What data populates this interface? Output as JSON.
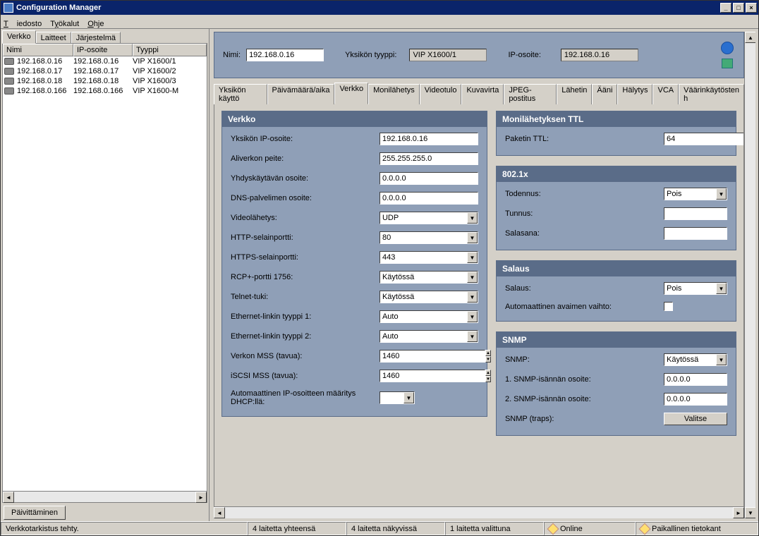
{
  "window": {
    "title": "Configuration Manager"
  },
  "menu": {
    "file": "Tiedosto",
    "tools": "Työkalut",
    "help": "Ohje"
  },
  "left_tabs": {
    "network": "Verkko",
    "devices": "Laitteet",
    "system": "Järjestelmä"
  },
  "list_headers": {
    "name": "Nimi",
    "ip": "IP-osoite",
    "type": "Tyyppi"
  },
  "devices": [
    {
      "name": "192.168.0.16",
      "ip": "192.168.0.16",
      "type": "VIP X1600/1"
    },
    {
      "name": "192.168.0.17",
      "ip": "192.168.0.17",
      "type": "VIP X1600/2"
    },
    {
      "name": "192.168.0.18",
      "ip": "192.168.0.18",
      "type": "VIP X1600/3"
    },
    {
      "name": "192.168.0.166",
      "ip": "192.168.0.166",
      "type": "VIP X1600-M"
    }
  ],
  "refresh_btn": "Päivittäminen",
  "header": {
    "name_lbl": "Nimi:",
    "name_val": "192.168.0.16",
    "type_lbl": "Yksikön tyyppi:",
    "type_val": "VIP X1600/1",
    "ip_lbl": "IP-osoite:",
    "ip_val": "192.168.0.16"
  },
  "tabs": {
    "usage": "Yksikön käyttö",
    "datetime": "Päivämäärä/aika",
    "network": "Verkko",
    "multicast": "Monilähetys",
    "videoin": "Videotulo",
    "stream": "Kuvavirta",
    "jpeg": "JPEG-postitus",
    "tx": "Lähetin",
    "audio": "Ääni",
    "alarm": "Hälytys",
    "vca": "VCA",
    "misuse": "Väärinkäytösten h"
  },
  "panels": {
    "network": {
      "title": "Verkko",
      "unit_ip_lbl": "Yksikön IP-osoite:",
      "unit_ip_val": "192.168.0.16",
      "subnet_lbl": "Aliverkon peite:",
      "subnet_val": "255.255.255.0",
      "gateway_lbl": "Yhdyskäytävän osoite:",
      "gateway_val": "0.0.0.0",
      "dns_lbl": "DNS-palvelimen osoite:",
      "dns_val": "0.0.0.0",
      "videotx_lbl": "Videolähetys:",
      "videotx_val": "UDP",
      "http_lbl": "HTTP-selainportti:",
      "http_val": "80",
      "https_lbl": "HTTPS-selainportti:",
      "https_val": "443",
      "rcp_lbl": "RCP+-portti 1756:",
      "rcp_val": "Käytössä",
      "telnet_lbl": "Telnet-tuki:",
      "telnet_val": "Käytössä",
      "eth1_lbl": "Ethernet-linkin tyyppi 1:",
      "eth1_val": "Auto",
      "eth2_lbl": "Ethernet-linkin tyyppi 2:",
      "eth2_val": "Auto",
      "mss_lbl": "Verkon MSS (tavua):",
      "mss_val": "1460",
      "iscsi_lbl": "iSCSI MSS (tavua):",
      "iscsi_val": "1460",
      "dhcp_lbl": "Automaattinen IP-osoitteen määritys DHCP:llä:"
    },
    "ttl": {
      "title": "Monilähetyksen TTL",
      "packet_lbl": "Paketin TTL:",
      "packet_val": "64"
    },
    "dot1x": {
      "title": "802.1x",
      "auth_lbl": "Todennus:",
      "auth_val": "Pois",
      "id_lbl": "Tunnus:",
      "id_val": "",
      "pwd_lbl": "Salasana:",
      "pwd_val": ""
    },
    "enc": {
      "title": "Salaus",
      "enc_lbl": "Salaus:",
      "enc_val": "Pois",
      "autokey_lbl": "Automaattinen avaimen vaihto:"
    },
    "snmp": {
      "title": "SNMP",
      "snmp_lbl": "SNMP:",
      "snmp_val": "Käytössä",
      "host1_lbl": "1. SNMP-isännän osoite:",
      "host1_val": "0.0.0.0",
      "host2_lbl": "2. SNMP-isännän osoite:",
      "host2_val": "0.0.0.0",
      "traps_lbl": "SNMP (traps):",
      "traps_btn": "Valitse"
    }
  },
  "status": {
    "scan": "Verkkotarkistus tehty.",
    "total": "4 laitetta yhteensä",
    "visible": "4 laitetta näkyvissä",
    "selected": "1 laitetta valittuna",
    "online": "Online",
    "localdb": "Paikallinen tietokant"
  }
}
